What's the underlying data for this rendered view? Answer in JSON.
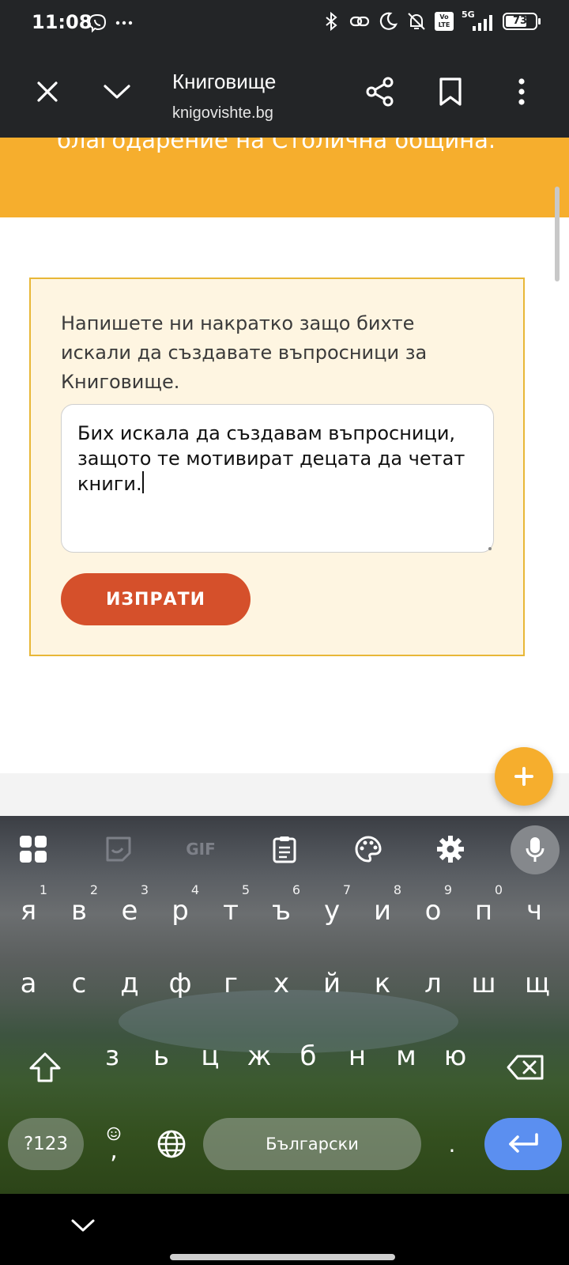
{
  "status_bar": {
    "time": "11:08",
    "icons": [
      "viber-icon",
      "more-dots-icon",
      "bluetooth-icon",
      "link-icon",
      "moon-icon",
      "bell-off-icon",
      "volte-icon",
      "5g-signal-icon",
      "battery-icon"
    ],
    "volte_label": "Vo LTE",
    "network_label": "5G",
    "battery": "73"
  },
  "browser": {
    "title": "Книговище",
    "domain": "knigovishte.bg"
  },
  "banner": {
    "text": "благодарение на Столична община."
  },
  "form": {
    "prompt": "Напишете ни накратко защо бихте искали да създавате въпросници за Книговище.",
    "answer": "Бих искала да създавам въпросници, защото те мотивират децата да четат книги.",
    "submit_label": "ИЗПРАТИ"
  },
  "keyboard": {
    "toolbar": [
      "apps-icon",
      "sticker-icon",
      "gif-icon",
      "clipboard-icon",
      "palette-icon",
      "settings-icon",
      "mic-icon"
    ],
    "gif_label": "GIF",
    "row1": [
      {
        "key": "я",
        "hint": "1"
      },
      {
        "key": "в",
        "hint": "2"
      },
      {
        "key": "е",
        "hint": "3"
      },
      {
        "key": "р",
        "hint": "4"
      },
      {
        "key": "т",
        "hint": "5"
      },
      {
        "key": "ъ",
        "hint": "6"
      },
      {
        "key": "у",
        "hint": "7"
      },
      {
        "key": "и",
        "hint": "8"
      },
      {
        "key": "о",
        "hint": "9"
      },
      {
        "key": "п",
        "hint": "0"
      },
      {
        "key": "ч",
        "hint": ""
      }
    ],
    "row2": [
      "а",
      "с",
      "д",
      "ф",
      "г",
      "х",
      "й",
      "к",
      "л",
      "ш",
      "щ"
    ],
    "row3": [
      "з",
      "ь",
      "ц",
      "ж",
      "б",
      "н",
      "м",
      "ю"
    ],
    "symbols_label": "?123",
    "comma_label": ",",
    "space_label": "Български",
    "period_label": "."
  },
  "colors": {
    "banner": "#f6ae2d",
    "card_bg": "#fef5e1",
    "card_border": "#e8b737",
    "submit_button": "#d5502b",
    "fab": "#f6ae2d",
    "enter_key": "#5b8ff0"
  }
}
